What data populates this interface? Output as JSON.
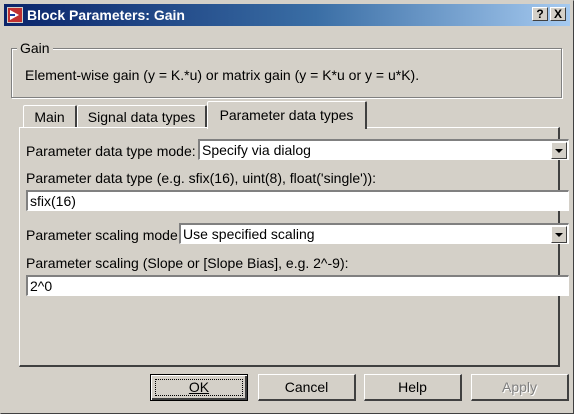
{
  "window": {
    "title": "Block Parameters: Gain",
    "help_button": "?",
    "close_button": "X"
  },
  "group": {
    "legend": "Gain",
    "description": "Element-wise gain (y = K.*u) or matrix gain (y = K*u or y = u*K)."
  },
  "tabs": [
    {
      "label": "Main"
    },
    {
      "label": "Signal data types"
    },
    {
      "label": "Parameter data types",
      "active": true
    }
  ],
  "form": {
    "param_dtype_mode_label": "Parameter data type mode:",
    "param_dtype_mode_value": "Specify via dialog",
    "param_dtype_label": "Parameter data type (e.g. sfix(16), uint(8), float('single')):",
    "param_dtype_value": "sfix(16)",
    "param_scaling_mode_label": "Parameter scaling mode",
    "param_scaling_mode_value": "Use specified scaling",
    "param_scaling_label": "Parameter scaling (Slope or [Slope Bias], e.g. 2^-9):",
    "param_scaling_value": "2^0"
  },
  "buttons": {
    "ok": "OK",
    "cancel": "Cancel",
    "help": "Help",
    "apply": "Apply"
  }
}
